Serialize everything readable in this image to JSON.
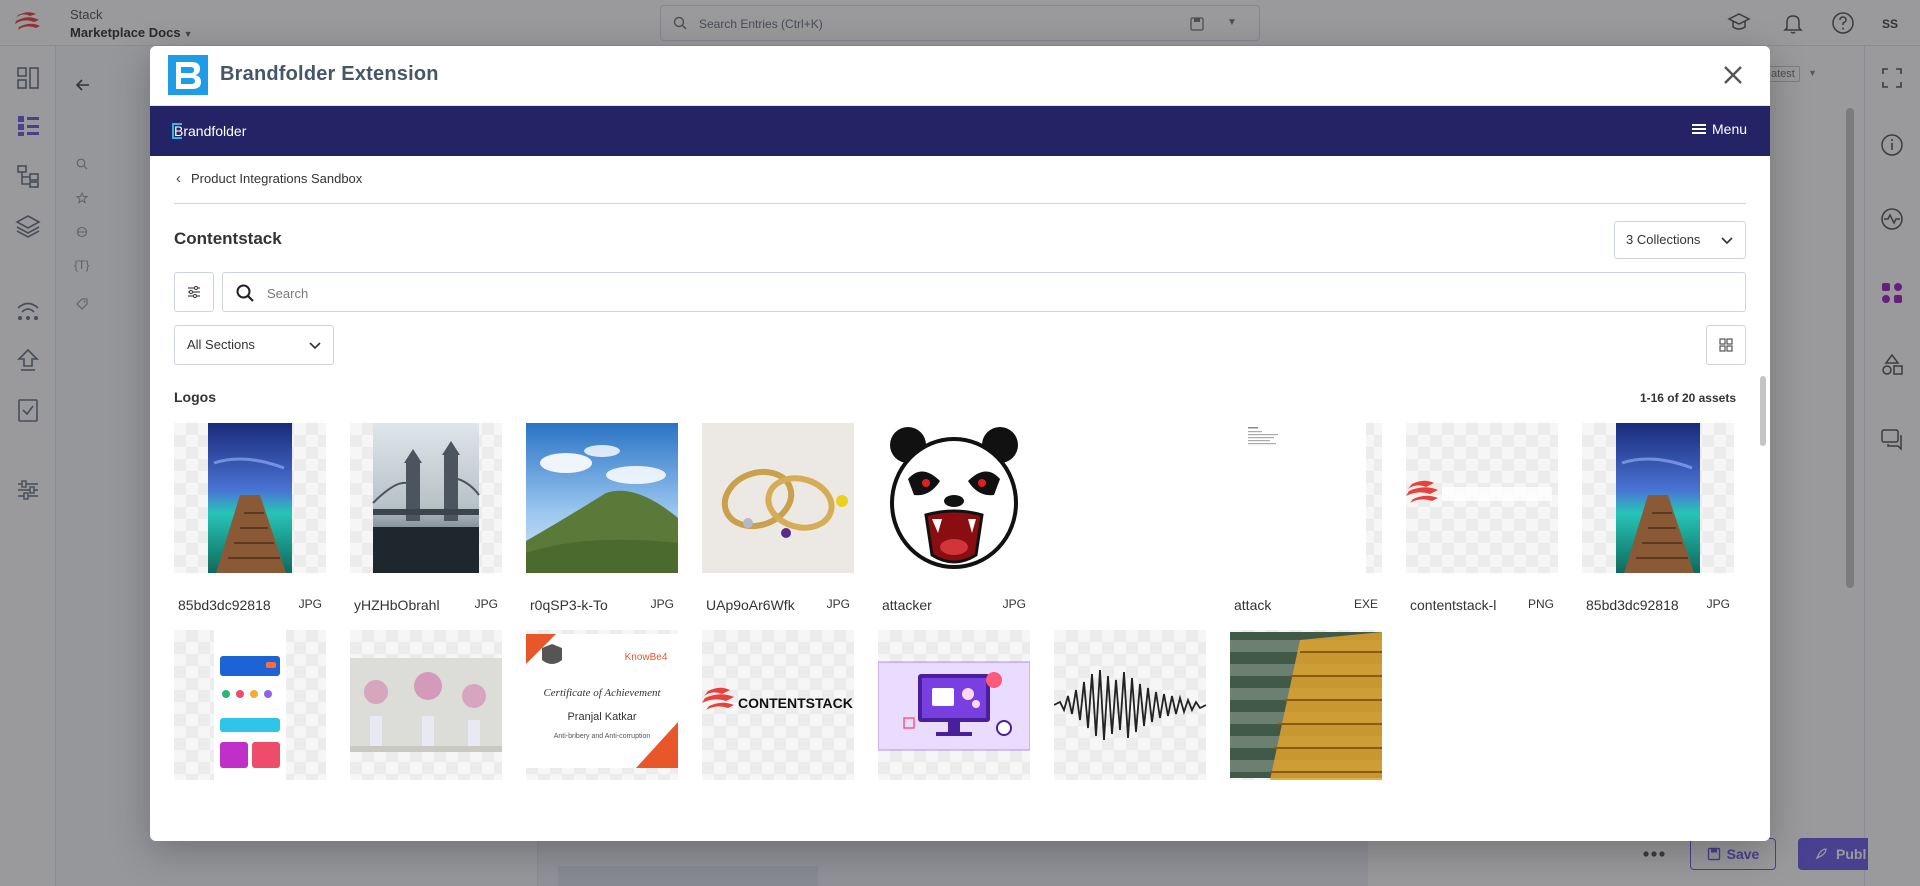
{
  "app": {
    "stack_label": "Stack",
    "stack_name": "Marketplace Docs",
    "search_placeholder": "Search Entries (Ctrl+K)",
    "avatar_initials": "SS",
    "background_tag": "atest",
    "save_label": "Save",
    "publish_label": "Publ"
  },
  "modal": {
    "title": "Brandfolder Extension",
    "brandfolder_wordmark": "Brandfolder",
    "menu_label": "Menu",
    "breadcrumb": "Product Integrations Sandbox",
    "brandfolder_name": "Contentstack",
    "collections_label": "3 Collections",
    "search_placeholder": "Search",
    "sections_label": "All Sections",
    "section_title": "Logos",
    "asset_count": "1-16 of 20 assets"
  },
  "assets_row1": [
    {
      "name": "85bd3dc92818",
      "type": "JPG",
      "icon": "pier-photo"
    },
    {
      "name": "yHZHbObrahl",
      "type": "JPG",
      "icon": "tower-bridge-photo"
    },
    {
      "name": "r0qSP3-k-To",
      "type": "JPG",
      "icon": "green-hill-photo"
    },
    {
      "name": "UAp9oAr6Wfk",
      "type": "JPG",
      "icon": "bracelets-photo"
    },
    {
      "name": "attacker",
      "type": "JPG",
      "icon": "panda-illustration"
    },
    {
      "name": "",
      "type": "",
      "icon": "empty"
    },
    {
      "name": "attack",
      "type": "EXE",
      "icon": "document-preview"
    },
    {
      "name": "contentstack-l",
      "type": "PNG",
      "icon": "contentstack-logo-faded"
    },
    {
      "name": "85bd3dc92818",
      "type": "JPG",
      "icon": "pier-photo"
    }
  ],
  "assets_row2": [
    {
      "icon": "mobile-app-screenshot"
    },
    {
      "icon": "pink-flowers-photo"
    },
    {
      "icon": "certificate-image",
      "text": {
        "brand": "KnowBe4",
        "heading": "Certificate of Achievement",
        "recipient": "Pranjal Katkar",
        "course": "Anti-bribery and Anti-corruption"
      }
    },
    {
      "icon": "contentstack-logo",
      "text": {
        "wordmark": "CONTENTSTACK"
      }
    },
    {
      "icon": "image-editing-illustration"
    },
    {
      "icon": "audio-waveform"
    },
    {
      "icon": "stairs-photo"
    }
  ],
  "colors": {
    "brandfolder_bar": "#232366",
    "accent_purple": "#6c5ce7",
    "contentstack_red": "#e8413b",
    "title_gray": "#475569"
  }
}
